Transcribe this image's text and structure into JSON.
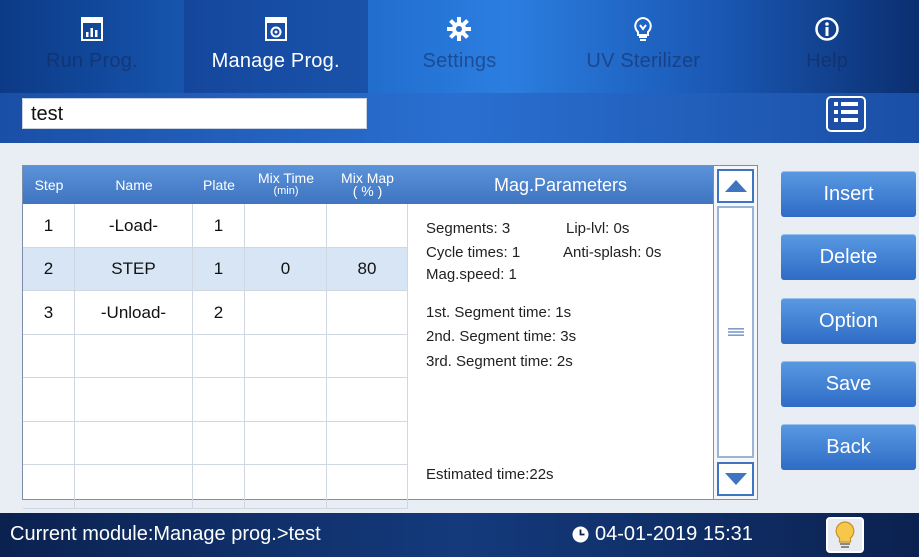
{
  "nav": {
    "tabs": [
      {
        "label": "Run Prog.",
        "icon": "chart-doc-icon"
      },
      {
        "label": "Manage Prog.",
        "icon": "manage-doc-icon"
      },
      {
        "label": "Settings",
        "icon": "gear-icon"
      },
      {
        "label": "UV Sterilizer",
        "icon": "uv-bulb-icon"
      },
      {
        "label": "Help",
        "icon": "info-icon"
      }
    ],
    "active": "Manage Prog."
  },
  "program": {
    "name": "test",
    "list_icon": "list-icon"
  },
  "table": {
    "headers": {
      "step": "Step",
      "name": "Name",
      "plate": "Plate",
      "mix_time": "Mix Time",
      "mix_time_unit": "(min)",
      "mix_map": "Mix Map",
      "mix_map_unit": "( % )",
      "mag": "Mag.Parameters"
    },
    "rows": [
      {
        "step": "1",
        "name": "-Load-",
        "plate": "1",
        "mix_time": "",
        "mix_map": ""
      },
      {
        "step": "2",
        "name": "STEP",
        "plate": "1",
        "mix_time": "0",
        "mix_map": "80"
      },
      {
        "step": "3",
        "name": "-Unload-",
        "plate": "2",
        "mix_time": "",
        "mix_map": ""
      },
      {
        "step": "",
        "name": "",
        "plate": "",
        "mix_time": "",
        "mix_map": ""
      },
      {
        "step": "",
        "name": "",
        "plate": "",
        "mix_time": "",
        "mix_map": ""
      },
      {
        "step": "",
        "name": "",
        "plate": "",
        "mix_time": "",
        "mix_map": ""
      },
      {
        "step": "",
        "name": "",
        "plate": "",
        "mix_time": "",
        "mix_map": ""
      }
    ],
    "selected_row": 2
  },
  "mag_params": {
    "segments": "Segments: 3",
    "lip_lvl": "Lip-lvl: 0s",
    "cycle_times": "Cycle times: 1",
    "anti_splash": "Anti-splash: 0s",
    "mag_speed": "Mag.speed: 1",
    "seg1": "1st. Segment time: 1s",
    "seg2": "2nd. Segment time: 3s",
    "seg3": "3rd. Segment time: 2s",
    "estimated": "Estimated time:22s"
  },
  "actions": {
    "insert": "Insert",
    "delete": "Delete",
    "option": "Option",
    "save": "Save",
    "back": "Back"
  },
  "status": {
    "module": "Current module:Manage prog.>test",
    "datetime": "04-01-2019 15:31",
    "clock_icon": "clock-icon",
    "bulb_icon": "bulb-icon"
  },
  "colors": {
    "header_blue": "#3f74c0",
    "button_blue": "#2e6cc6",
    "selected_row": "#d7e5f5",
    "status_bar": "#0b2250"
  }
}
